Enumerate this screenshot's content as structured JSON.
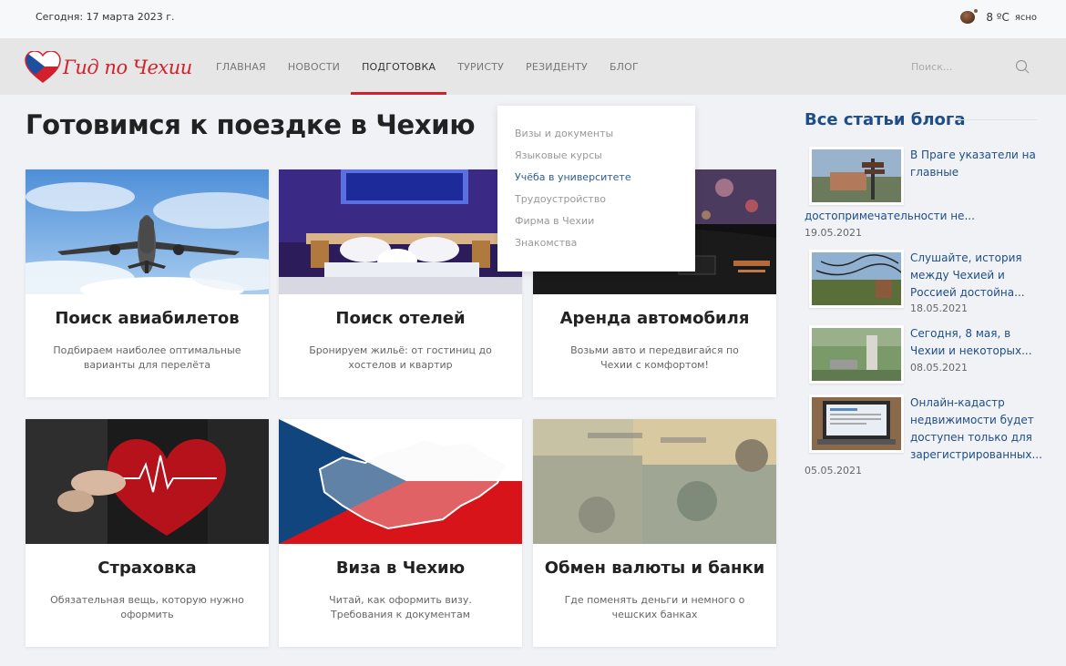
{
  "topbar": {
    "date": "Сегодня: 17 марта 2023 г.",
    "weather": {
      "icon": "weather-planet-icon",
      "temp": "8 ºC",
      "condition": "ясно"
    }
  },
  "nav": {
    "logo_text": "Гид по Чехии",
    "items": [
      {
        "label": "ГЛАВНАЯ"
      },
      {
        "label": "НОВОСТИ"
      },
      {
        "label": "ПОДГОТОВКА",
        "active": true
      },
      {
        "label": "ТУРИСТУ"
      },
      {
        "label": "РЕЗИДЕНТУ"
      },
      {
        "label": "БЛОГ"
      }
    ],
    "search_placeholder": "Поиск..."
  },
  "dropdown": {
    "items": [
      {
        "label": "Визы и документы"
      },
      {
        "label": "Языковые курсы"
      },
      {
        "label": "Учёба в университете",
        "highlighted": true
      },
      {
        "label": "Трудоустройство"
      },
      {
        "label": "Фирма в Чехии"
      },
      {
        "label": "Знакомства"
      }
    ]
  },
  "main": {
    "title": "Готовимся к поездке в Чехию",
    "cards": [
      {
        "title": "Поиск авиабилетов",
        "desc": "Подбираем наиболее оптимальные варианты для перелёта"
      },
      {
        "title": "Поиск отелей",
        "desc": "Бронируем жильё: от гостиниц до хостелов и квартир"
      },
      {
        "title": "Аренда автомобиля",
        "desc": "Возьми авто и передвигайся по Чехии с комфортом!"
      },
      {
        "title": "Страховка",
        "desc": "Обязательная вещь, которую нужно оформить"
      },
      {
        "title": "Виза в Чехию",
        "desc": "Читай, как оформить визу. Требования к документам"
      },
      {
        "title": "Обмен валюты и банки",
        "desc": "Где поменять деньги и немного о чешских банках"
      }
    ]
  },
  "sidebar": {
    "title": "Все статьи блога",
    "posts": [
      {
        "text1": "В Праге указатели на",
        "text2": "главные",
        "text3": "достопримечательности не...",
        "date": "19.05.2021"
      },
      {
        "text1": "Слушайте, история",
        "text2": "между Чехией и",
        "text3": "Россией достойна...",
        "date": "18.05.2021"
      },
      {
        "text1": "Сегодня, 8 мая, в",
        "text2": "Чехии и некоторых...",
        "date": "08.05.2021"
      },
      {
        "text1": "Онлайн-кадастр",
        "text2": "недвижимости будет",
        "text3": "доступен только для",
        "text4": "зарегистрированных...",
        "date": "05.05.2021"
      }
    ]
  },
  "colors": {
    "brand_red": "#d4202a",
    "link_blue": "#1f4e86"
  }
}
